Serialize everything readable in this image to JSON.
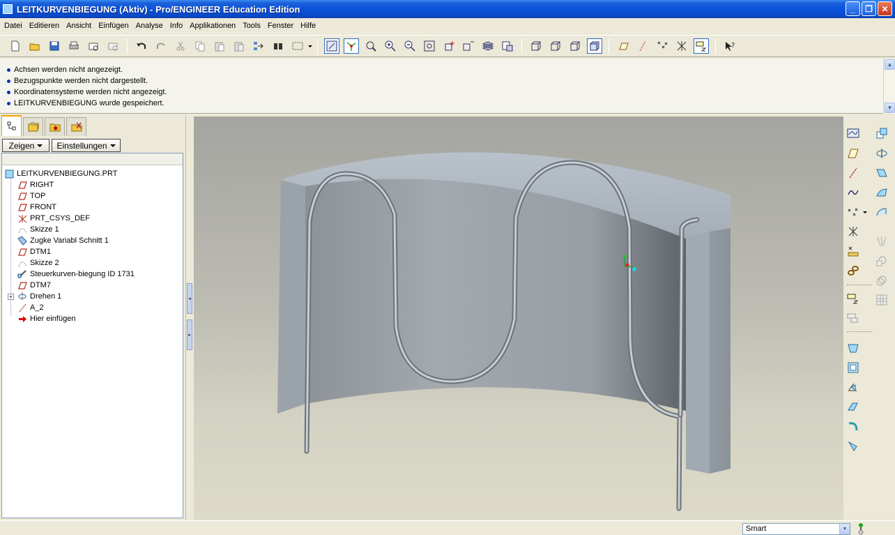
{
  "window": {
    "title": "LEITKURVENBIEGUNG (Aktiv) - Pro/ENGINEER Education Edition",
    "buttons": [
      "_",
      "❐",
      "✕"
    ]
  },
  "menu": [
    "Datei",
    "Editieren",
    "Ansicht",
    "Einfügen",
    "Analyse",
    "Info",
    "Applikationen",
    "Tools",
    "Fenster",
    "Hilfe"
  ],
  "toolbar": {
    "icons": [
      "new-icon",
      "open-icon",
      "save-icon",
      "print-icon",
      "email-icon",
      "email-link-icon",
      "undo-icon",
      "redo-icon",
      "cut-icon",
      "copy-icon",
      "paste-icon",
      "paste-special-icon",
      "regenerate-icon",
      "find-icon",
      "select-box-icon",
      "repaint-icon",
      "spin-center-icon",
      "orient-mode-icon",
      "zoom-in-icon",
      "zoom-out-icon",
      "refit-icon",
      "reorient-icon",
      "saved-views-icon",
      "layers-icon",
      "view-manager-icon",
      "wireframe-icon",
      "hidden-line-icon",
      "no-hidden-icon",
      "shading-icon",
      "datum-planes-icon",
      "datum-axes-icon",
      "datum-points-icon",
      "csys-icon",
      "annotation-icon",
      "context-help-icon"
    ]
  },
  "messages": [
    "Achsen werden nicht angezeigt.",
    "Bezugspunkte werden nicht dargestellt.",
    "Koordinatensysteme werden nicht angezeigt.",
    "LEITKURVENBIEGUNG wurde gespeichert."
  ],
  "navigator": {
    "show_label": "Zeigen",
    "settings_label": "Einstellungen",
    "root": "LEITKURVENBIEGUNG.PRT",
    "items": [
      {
        "label": "RIGHT",
        "icon": "datum-plane-icon"
      },
      {
        "label": "TOP",
        "icon": "datum-plane-icon"
      },
      {
        "label": "FRONT",
        "icon": "datum-plane-icon"
      },
      {
        "label": "PRT_CSYS_DEF",
        "icon": "csys-icon"
      },
      {
        "label": "Skizze 1",
        "icon": "sketch-icon"
      },
      {
        "label": "Zugke Variabl Schnitt 1",
        "icon": "sweep-icon"
      },
      {
        "label": "DTM1",
        "icon": "datum-plane-icon"
      },
      {
        "label": "Skizze 2",
        "icon": "sketch-icon"
      },
      {
        "label": "Steuerkurven-biegung ID 1731",
        "icon": "bend-icon"
      },
      {
        "label": "DTM7",
        "icon": "datum-plane-icon"
      },
      {
        "label": "Drehen 1",
        "icon": "revolve-icon"
      },
      {
        "label": "A_2",
        "icon": "datum-axis-icon"
      },
      {
        "label": "Hier einfügen",
        "icon": "insert-here-icon"
      }
    ]
  },
  "status": {
    "filter_value": "Smart"
  },
  "colors": {
    "title_bar": "#0a52dc",
    "model": "#9aa4ad",
    "datum_plane": "#c0392b",
    "insert_arrow": "#e00000"
  }
}
